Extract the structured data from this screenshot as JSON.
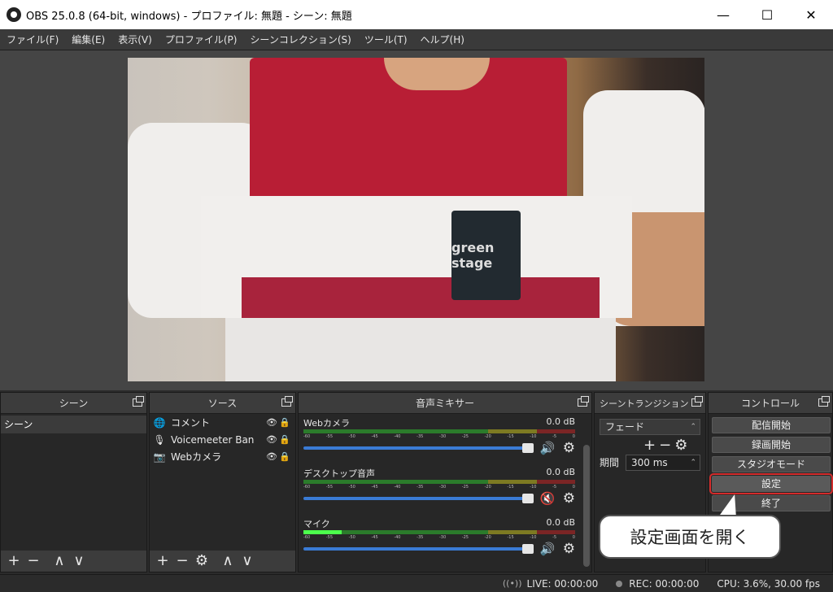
{
  "window": {
    "title": "OBS 25.0.8 (64-bit, windows) - プロファイル: 無題 - シーン: 無題",
    "minimize": "—",
    "maximize": "☐",
    "close": "✕"
  },
  "menu": [
    "ファイル(F)",
    "編集(E)",
    "表示(V)",
    "プロファイル(P)",
    "シーンコレクション(S)",
    "ツール(T)",
    "ヘルプ(H)"
  ],
  "preview": {
    "pocket_text": "green stage"
  },
  "scenes": {
    "header": "シーン",
    "items": [
      "シーン"
    ],
    "toolbar": [
      "+",
      "−",
      "∧",
      "∨"
    ]
  },
  "sources": {
    "header": "ソース",
    "items": [
      {
        "label": "コメント",
        "icon": "globe-icon",
        "glyph": "🌐"
      },
      {
        "label": "Voicemeeter Ban",
        "icon": "microphone-icon",
        "glyph": "🎙"
      },
      {
        "label": "Webカメラ",
        "icon": "camera-icon",
        "glyph": "📷"
      }
    ],
    "eye_glyph": "👁",
    "lock_glyph": "🔒",
    "toolbar": [
      "+",
      "−",
      "⚙",
      "∧",
      "∨"
    ]
  },
  "mixer": {
    "header": "音声ミキサー",
    "scale": [
      "-60",
      "-55",
      "-50",
      "-45",
      "-40",
      "-35",
      "-30",
      "-25",
      "-20",
      "-15",
      "-10",
      "-5",
      "0"
    ],
    "channels": [
      {
        "name": "Webカメラ",
        "db": "0.0 dB",
        "level": 0.0,
        "muted": false
      },
      {
        "name": "デスクトップ音声",
        "db": "0.0 dB",
        "level": 0.0,
        "muted": true
      },
      {
        "name": "マイク",
        "db": "0.0 dB",
        "level": 0.14,
        "muted": false
      }
    ],
    "vol_glyph": "🔊",
    "muted_glyph": "🔇",
    "gear_glyph": "⚙"
  },
  "transitions": {
    "header": "シーントランジション",
    "selected": "フェード",
    "add": "+",
    "remove": "−",
    "gear": "⚙",
    "duration_label": "期間",
    "duration_value": "300 ms"
  },
  "controls": {
    "header": "コントロール",
    "start_streaming": "配信開始",
    "start_recording": "録画開始",
    "studio_mode": "スタジオモード",
    "settings": "設定",
    "exit": "終了"
  },
  "callout": {
    "text": "設定画面を開く"
  },
  "status": {
    "live": "LIVE: 00:00:00",
    "rec": "REC: 00:00:00",
    "cpu": "CPU: 3.6%, 30.00 fps"
  },
  "colors": {
    "highlight": "#d42b2b",
    "fader": "#3a7bd5",
    "panel_bg": "#272727"
  }
}
